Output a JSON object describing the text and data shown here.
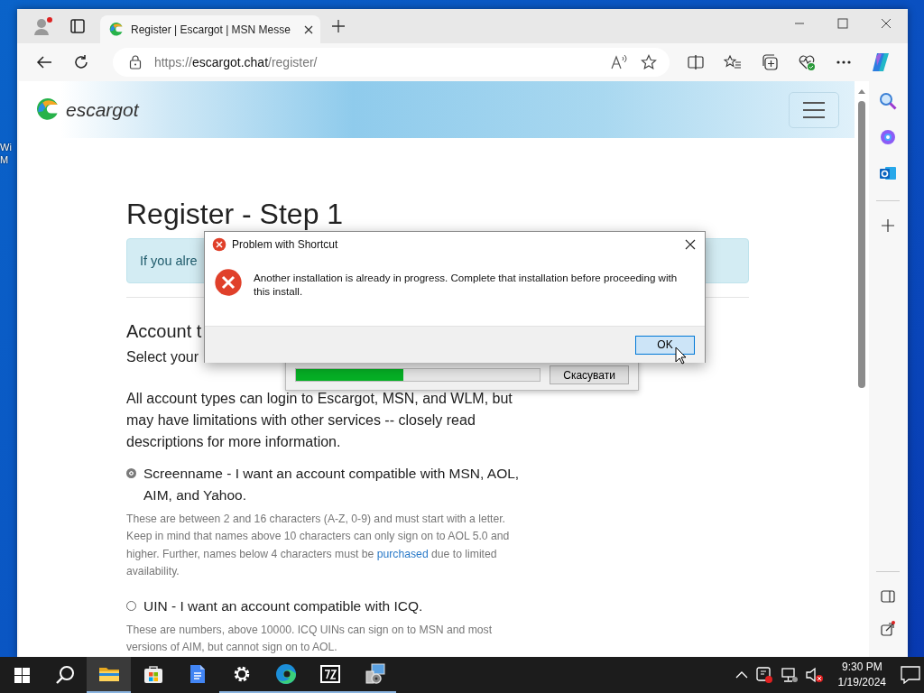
{
  "desktop": {
    "icon_label_lines": [
      "Wi",
      "M"
    ]
  },
  "browser": {
    "tabs": [
      {
        "title": "Register | Escargot | MSN Messe",
        "selected": true
      }
    ],
    "address": {
      "scheme": "https://",
      "host": "escargot.chat",
      "path": "/register/"
    }
  },
  "page": {
    "logo": "escargot",
    "heading": "Register - Step 1",
    "alert": "If you alre",
    "section_heading": "Account t",
    "select_prompt": "Select your",
    "intro": "All account types can login to Escargot, MSN, and WLM, but may have limitations with other services -- closely read descriptions for more information.",
    "options": [
      {
        "label": "Screenname - I want an account compatible with MSN, AOL, AIM, and Yahoo.",
        "selected": true,
        "description": "These are between 2 and 16 characters (A-Z, 0-9) and must start with a letter. Keep in mind that names above 10 characters can only sign on to AOL 5.0 and higher. Further, names below 4 characters must be",
        "link": "purchased",
        "description_end": "due to limited availability."
      },
      {
        "label": "UIN - I want an account compatible with ICQ.",
        "selected": false,
        "description": "These are numbers, above 10000. ICQ UINs can sign on to MSN and most versions of AIM, but cannot sign on to AOL."
      }
    ]
  },
  "dialog": {
    "title": "Problem with Shortcut",
    "message": "Another installation is already in progress. Complete that installation before proceeding with this install.",
    "button": "OK"
  },
  "progress_window": {
    "level": 0.44,
    "button": "Скасувати"
  },
  "taskbar": {
    "apps": [
      {
        "kind": "explorer",
        "active": true,
        "running": true
      },
      {
        "kind": "store",
        "active": false,
        "running": false
      },
      {
        "kind": "docs",
        "active": false,
        "running": false
      },
      {
        "kind": "settings",
        "active": false,
        "running": true
      },
      {
        "kind": "edge",
        "active": false,
        "running": true
      },
      {
        "kind": "archiver",
        "active": false,
        "running": true
      },
      {
        "kind": "installer",
        "active": false,
        "running": true
      }
    ],
    "time": "9:30 PM",
    "date": "1/19/2024"
  }
}
